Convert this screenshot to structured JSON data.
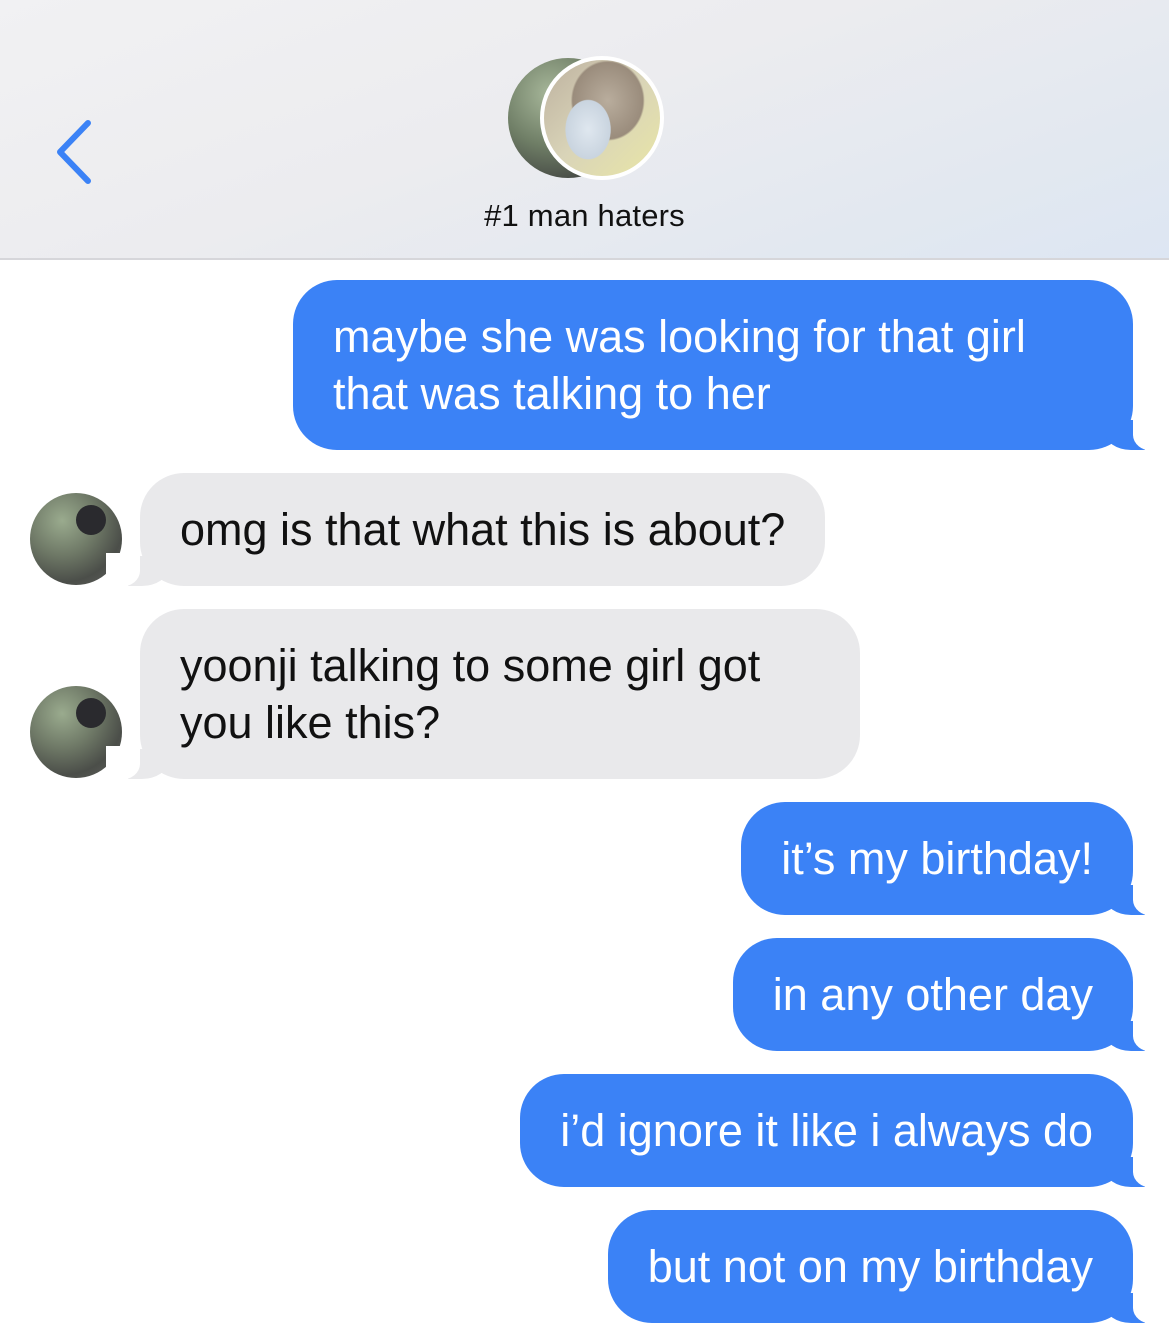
{
  "header": {
    "back_icon": "chevron-left-icon",
    "title": "#1 man haters",
    "accent": "#3b82f6"
  },
  "colors": {
    "sent_bubble": "#3b82f6",
    "received_bubble": "#e9e9eb",
    "background": "#ffffff"
  },
  "messages": [
    {
      "direction": "sent",
      "text": "maybe she was looking for that girl that was talking to her"
    },
    {
      "direction": "received",
      "text": "omg is that what this is about?"
    },
    {
      "direction": "received",
      "text": "yoonji talking to some girl got you like this?"
    },
    {
      "direction": "sent",
      "text": "it’s my birthday!"
    },
    {
      "direction": "sent",
      "text": "in any other day"
    },
    {
      "direction": "sent",
      "text": "i’d ignore it like i always do"
    },
    {
      "direction": "sent",
      "text": "but not on my birthday"
    }
  ]
}
